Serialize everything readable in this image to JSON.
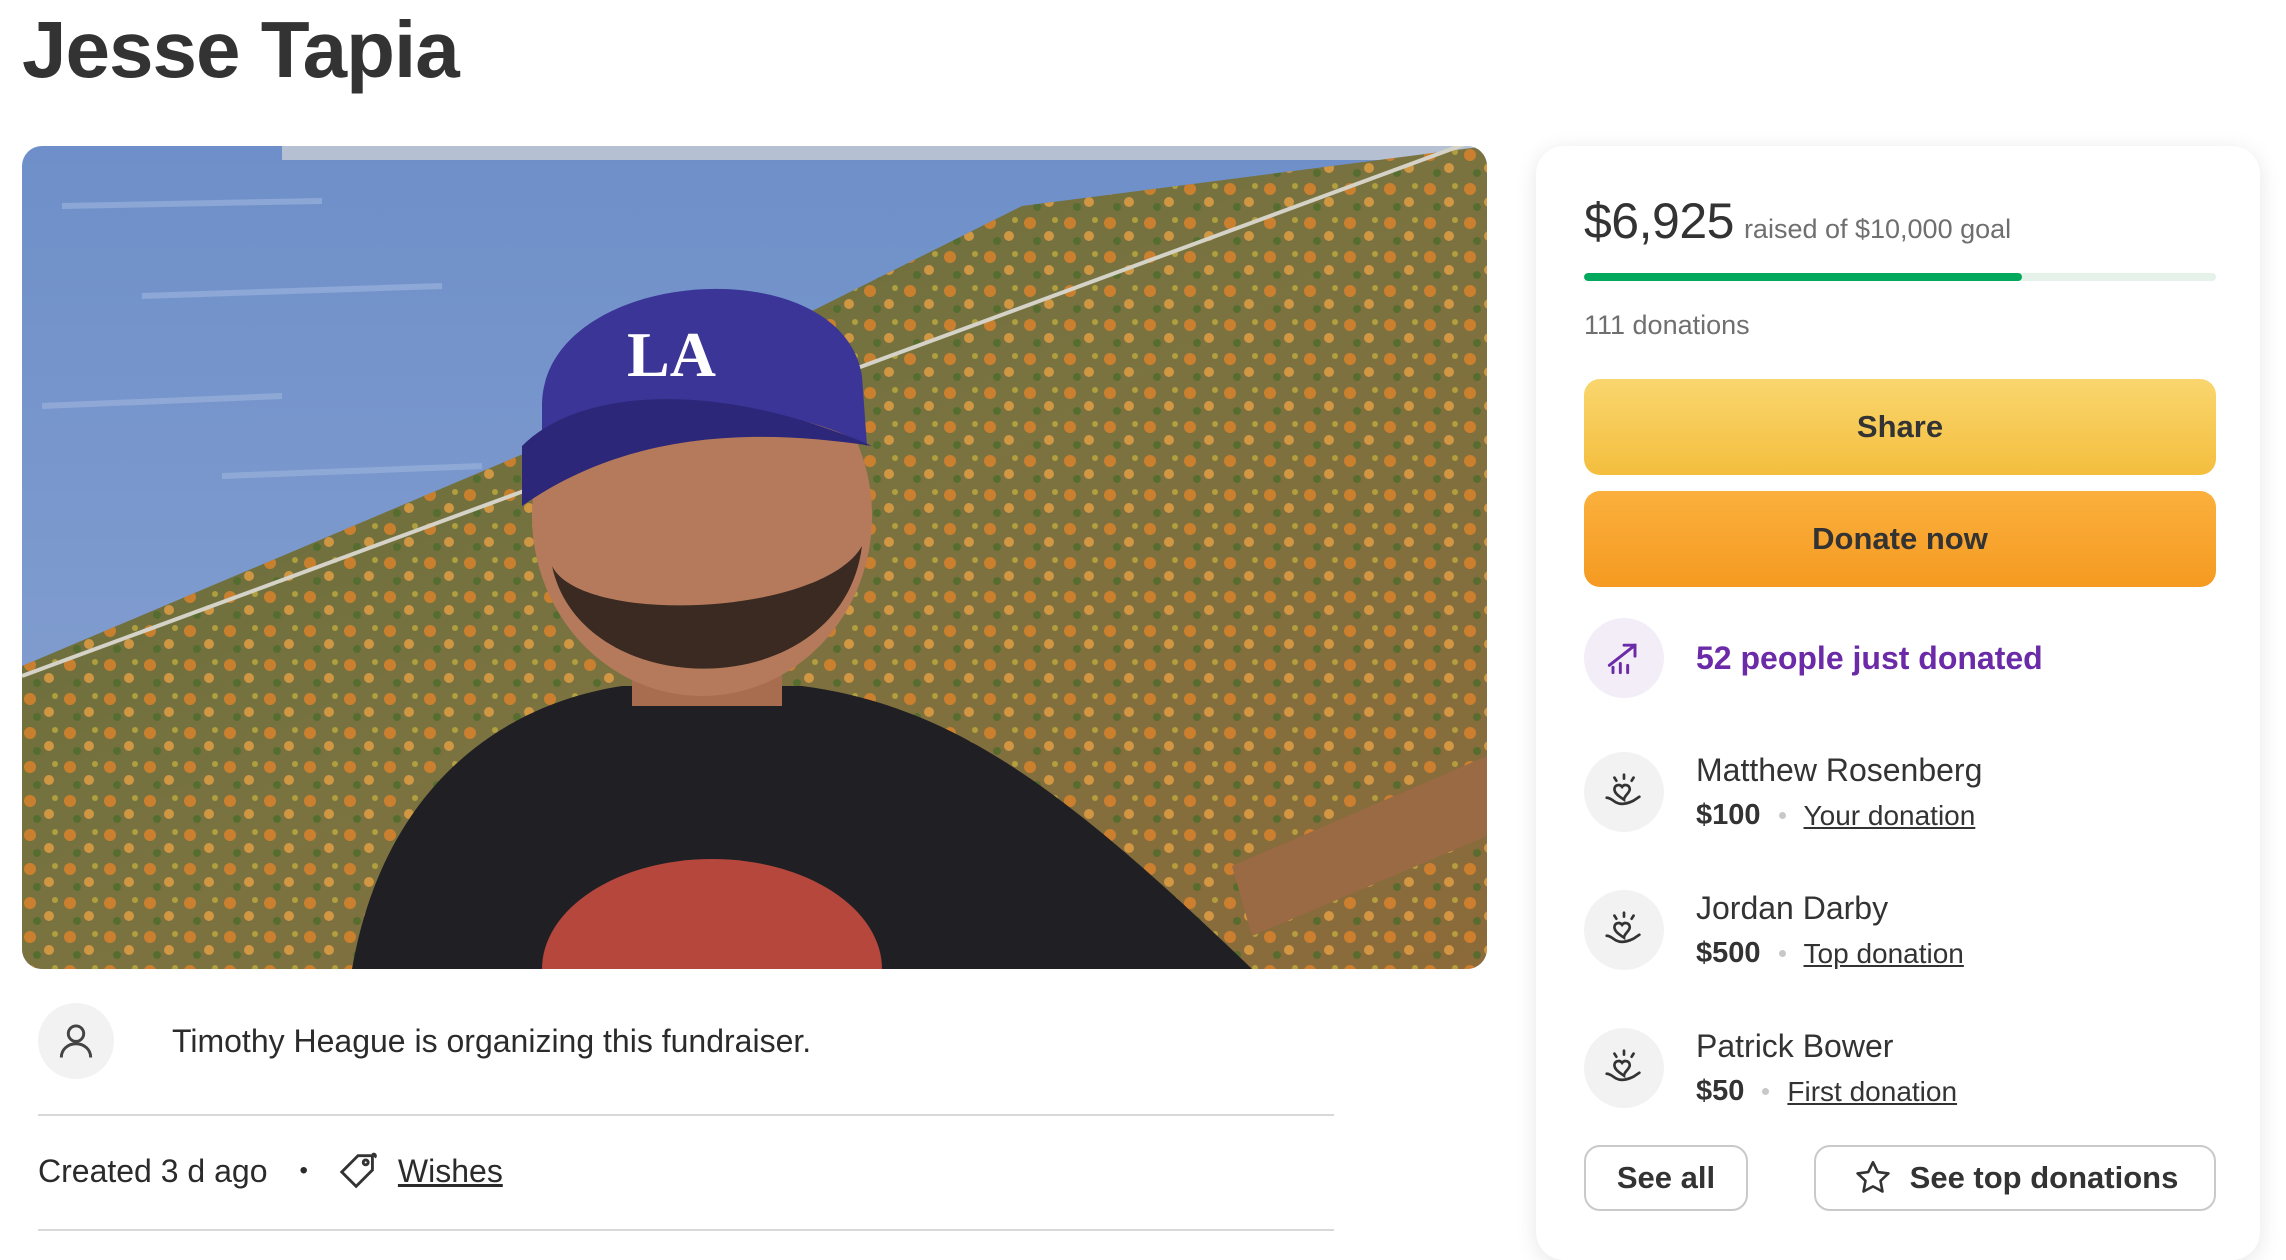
{
  "page": {
    "title": "Jesse Tapia"
  },
  "hero": {
    "cap_logo": "LA"
  },
  "organizer": {
    "text": "Timothy Heague is organizing this fundraiser."
  },
  "meta": {
    "created": "Created 3 d ago",
    "separator": "•",
    "tag_label": "Wishes"
  },
  "card": {
    "raised": "$6,925",
    "goal_text": "raised of $10,000 goal",
    "progress_fraction": 0.6925,
    "donation_count": "111 donations",
    "share_label": "Share",
    "donate_label": "Donate now",
    "trend_text": "52 people just donated",
    "donors": [
      {
        "name": "Matthew Rosenberg",
        "amount": "$100",
        "note": "Your donation"
      },
      {
        "name": "Jordan Darby",
        "amount": "$500",
        "note": "Top donation"
      },
      {
        "name": "Patrick Bower",
        "amount": "$50",
        "note": "First donation"
      }
    ],
    "see_all_label": "See all",
    "see_top_label": "See top donations"
  },
  "colors": {
    "progress": "#02a95c",
    "trend": "#6b2aa7",
    "share_button": "#f6c84f",
    "donate_button": "#f7a52c"
  },
  "icons": {
    "organizer": "person-icon",
    "tag": "tag-icon",
    "trend": "trending-up-icon",
    "donor": "heart-hand-icon",
    "star": "star-icon"
  }
}
